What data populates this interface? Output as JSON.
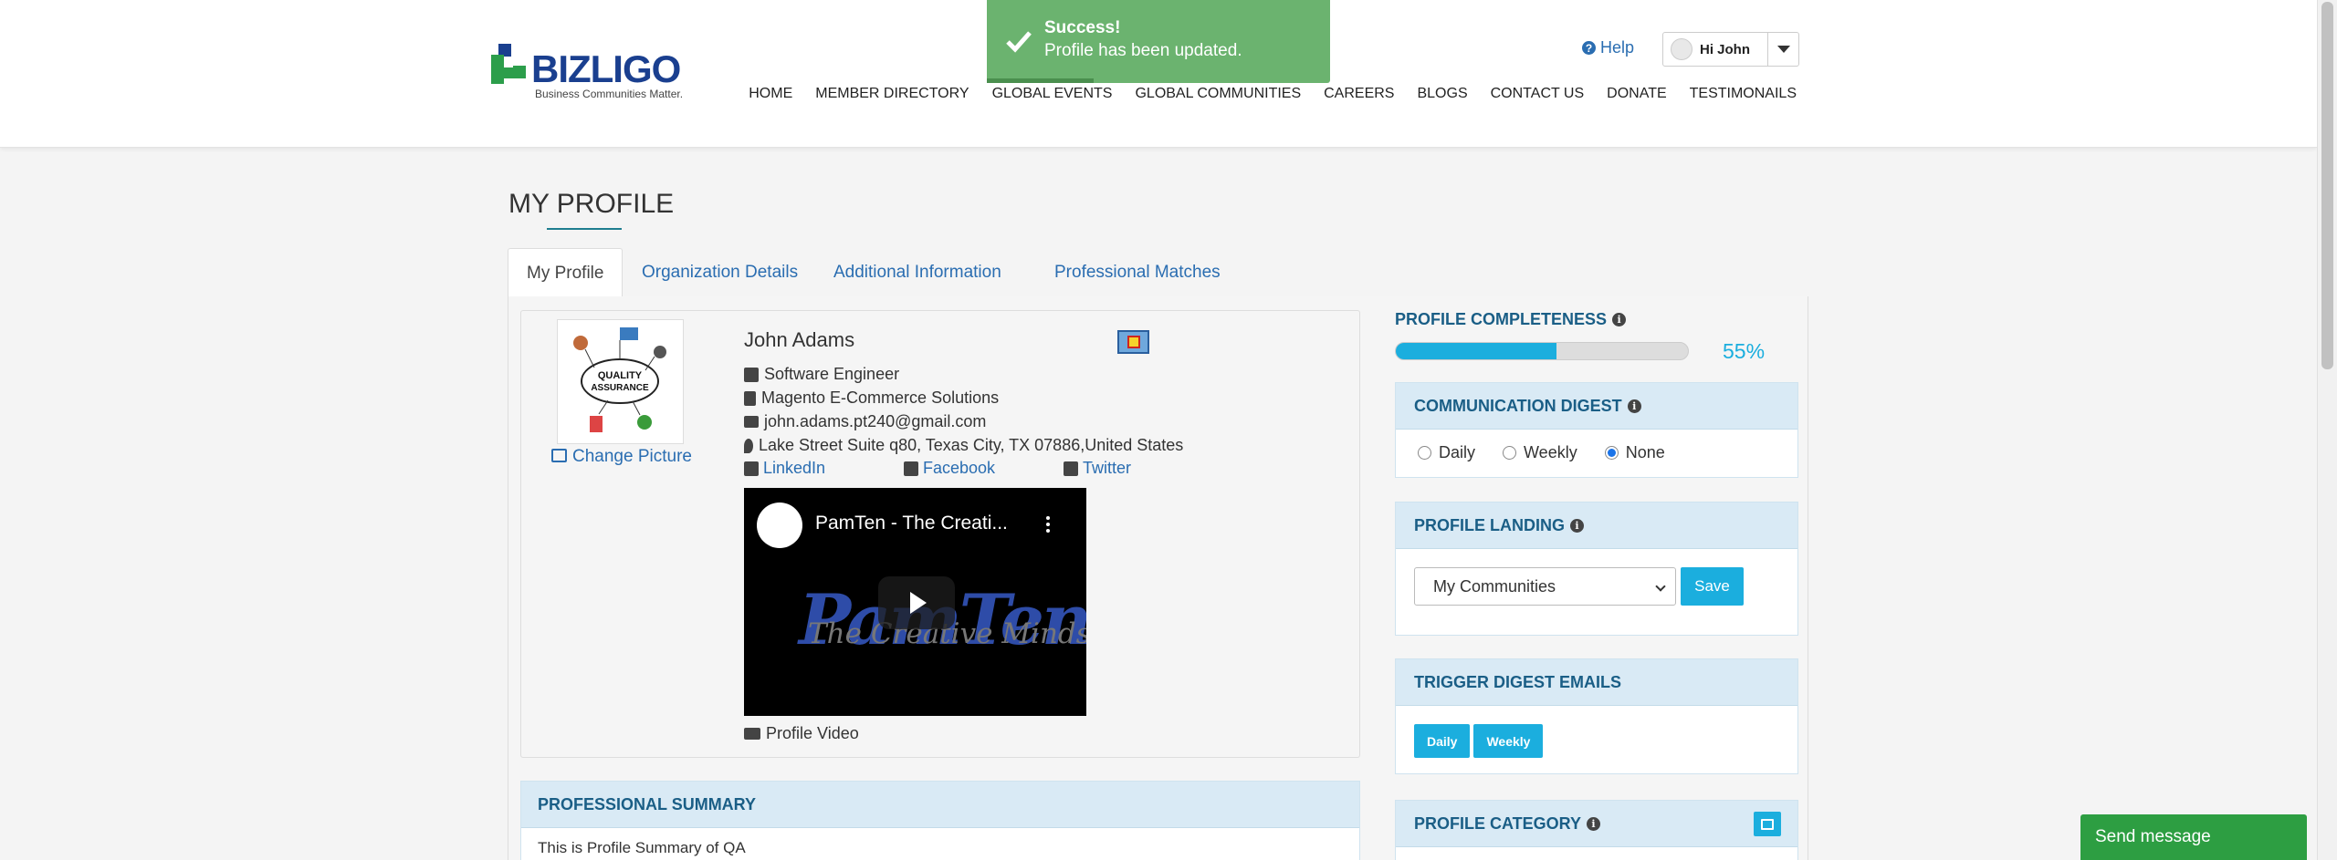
{
  "brand": {
    "name": "BIZLIGO",
    "tagline": "Business Communities Matter."
  },
  "nav": [
    "HOME",
    "MEMBER DIRECTORY",
    "GLOBAL EVENTS",
    "GLOBAL COMMUNITIES",
    "CAREERS",
    "BLOGS",
    "CONTACT US",
    "DONATE",
    "TESTIMONAILS"
  ],
  "header": {
    "help": "Help",
    "user_greeting": "Hi John"
  },
  "toast": {
    "title": "Success!",
    "message": "Profile has been updated."
  },
  "page": {
    "title": "MY PROFILE",
    "tabs": [
      "My Profile",
      "Organization Details",
      "Additional Information",
      "Professional Matches"
    ],
    "active_tab": "My Profile"
  },
  "profile": {
    "change_picture": "Change Picture",
    "name": "John Adams",
    "job_title": "Software Engineer",
    "company": "Magento E-Commerce Solutions",
    "email": "john.adams.pt240@gmail.com",
    "address": "Lake Street Suite q80, Texas City, TX 07886,United States",
    "social": {
      "linkedin": "LinkedIn",
      "facebook": "Facebook",
      "twitter": "Twitter"
    },
    "video": {
      "title": "PamTen - The Creati...",
      "logo_text": "PamTen",
      "tagline": "The Creative Minds"
    },
    "video_label": "Profile Video",
    "picture_text": "QUALITY ASSURANCE"
  },
  "summary": {
    "heading": "PROFESSIONAL SUMMARY",
    "text": "This is Profile Summary of QA"
  },
  "sidebar": {
    "completeness": {
      "label": "PROFILE COMPLETENESS",
      "value": 55,
      "display": "55%"
    },
    "digest": {
      "heading": "COMMUNICATION DIGEST",
      "options": [
        "Daily",
        "Weekly",
        "None"
      ],
      "selected": "None"
    },
    "landing": {
      "heading": "PROFILE LANDING",
      "selected": "My Communities",
      "save_label": "Save"
    },
    "trigger": {
      "heading": "TRIGGER DIGEST EMAILS",
      "buttons": [
        "Daily",
        "Weekly"
      ]
    },
    "category": {
      "heading": "PROFILE CATEGORY"
    }
  },
  "chat": {
    "label": "Send message"
  },
  "colors": {
    "accent": "#1baede",
    "link": "#2a6db1",
    "success": "#6bb36f",
    "heading": "#1a5e86",
    "chat": "#2d9e42"
  }
}
